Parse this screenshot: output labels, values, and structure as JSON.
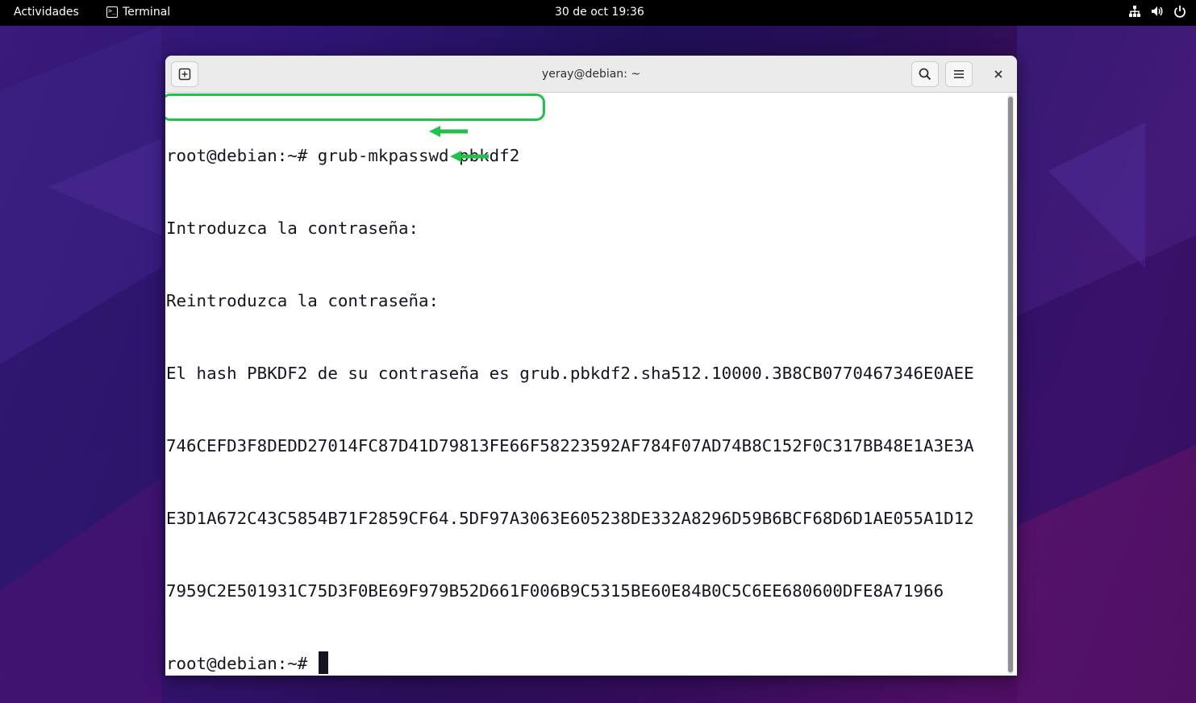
{
  "topbar": {
    "activities": "Actividades",
    "app_name": "Terminal",
    "clock": "30 de oct  19:36"
  },
  "window": {
    "title": "yeray@debian: ~"
  },
  "terminal": {
    "lines": [
      "root@debian:~# grub-mkpasswd-pbkdf2",
      "Introduzca la contraseña:",
      "Reintroduzca la contraseña:",
      "El hash PBKDF2 de su contraseña es grub.pbkdf2.sha512.10000.3B8CB0770467346E0AEE",
      "746CEFD3F8DEDD27014FC87D41D79813FE66F58223592AF784F07AD74B8C152F0C317BB48E1A3E3A",
      "E3D1A672C43C5854B71F2859CF64.5DF97A3063E605238DE332A8296D59B6BCF68D6D1AE055A1D12",
      "7959C2E501931C75D3F0BE69F979B52D661F006B9C5315BE60E84B0C5C6EE680600DFE8A71966"
    ],
    "prompt": "root@debian:~#"
  },
  "colors": {
    "annotation_green": "#22c24a",
    "terminal_fg": "#171421",
    "terminal_bg": "#ffffff"
  },
  "icons": {
    "new_tab": "new-tab-icon",
    "search": "search-icon",
    "menu": "hamburger-menu-icon",
    "close": "close-icon",
    "network": "network-icon",
    "volume": "volume-icon",
    "power": "power-icon"
  }
}
